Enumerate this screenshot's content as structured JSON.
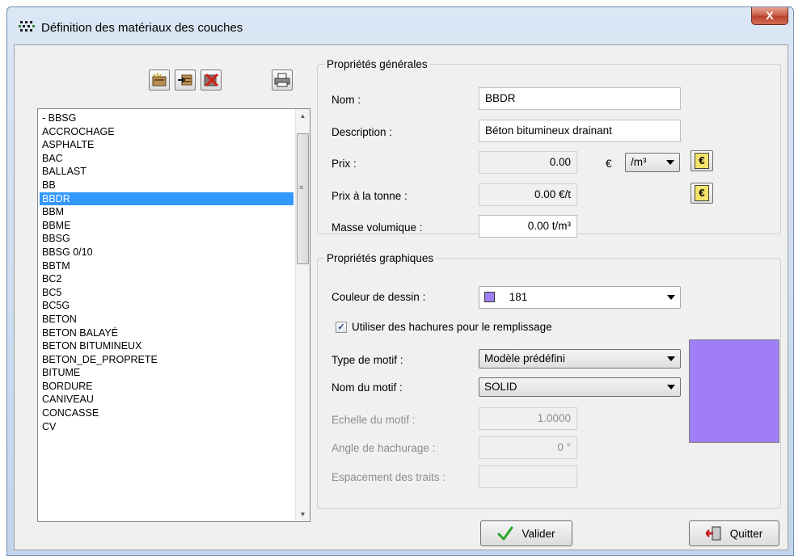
{
  "window": {
    "title": "Définition des matériaux des couches",
    "close_label": "X"
  },
  "toolbar": {
    "icons": [
      "new-material-icon",
      "import-material-icon",
      "delete-material-icon",
      "print-icon"
    ]
  },
  "materials_list": {
    "items": [
      "- BBSG",
      "ACCROCHAGE",
      "ASPHALTE",
      "BAC",
      "BALLAST",
      "BB",
      "BBDR",
      "BBM",
      "BBME",
      "BBSG",
      "BBSG 0/10",
      "BBTM",
      "BC2",
      "BC5",
      "BC5G",
      "BETON",
      "BETON BALAYÉ",
      "BETON BITUMINEUX",
      "BETON_DE_PROPRETE",
      "BITUME",
      "BORDURE",
      "CANIVEAU",
      "CONCASSE",
      "CV"
    ],
    "selected": "BBDR"
  },
  "general": {
    "legend": "Propriétés générales",
    "nom_label": "Nom :",
    "nom_value": "BBDR",
    "description_label": "Description :",
    "description_value": "Béton bitumineux drainant",
    "prix_label": "Prix :",
    "prix_value": "0.00",
    "prix_currency": "€",
    "prix_unit": "/m³",
    "prix_tonne_label": "Prix à la tonne :",
    "prix_tonne_value": "0.00 €/t",
    "masse_label": "Masse volumique :",
    "masse_value": "0.00 t/m³"
  },
  "graphic": {
    "legend": "Propriétés graphiques",
    "couleur_label": "Couleur de dessin :",
    "couleur_value": "181",
    "color_hex": "#a07ef5",
    "hachures_label": "Utiliser des hachures pour le remplissage",
    "hachures_checked": true,
    "type_motif_label": "Type de motif :",
    "type_motif_value": "Modèle prédéfini",
    "nom_motif_label": "Nom du motif :",
    "nom_motif_value": "SOLID",
    "echelle_label": "Echelle du motif :",
    "echelle_value": "1.0000",
    "angle_label": "Angle de hachurage :",
    "angle_value": "0 °",
    "espacement_label": "Espacement des traits :",
    "espacement_value": ""
  },
  "buttons": {
    "valider": "Valider",
    "quitter": "Quitter"
  }
}
